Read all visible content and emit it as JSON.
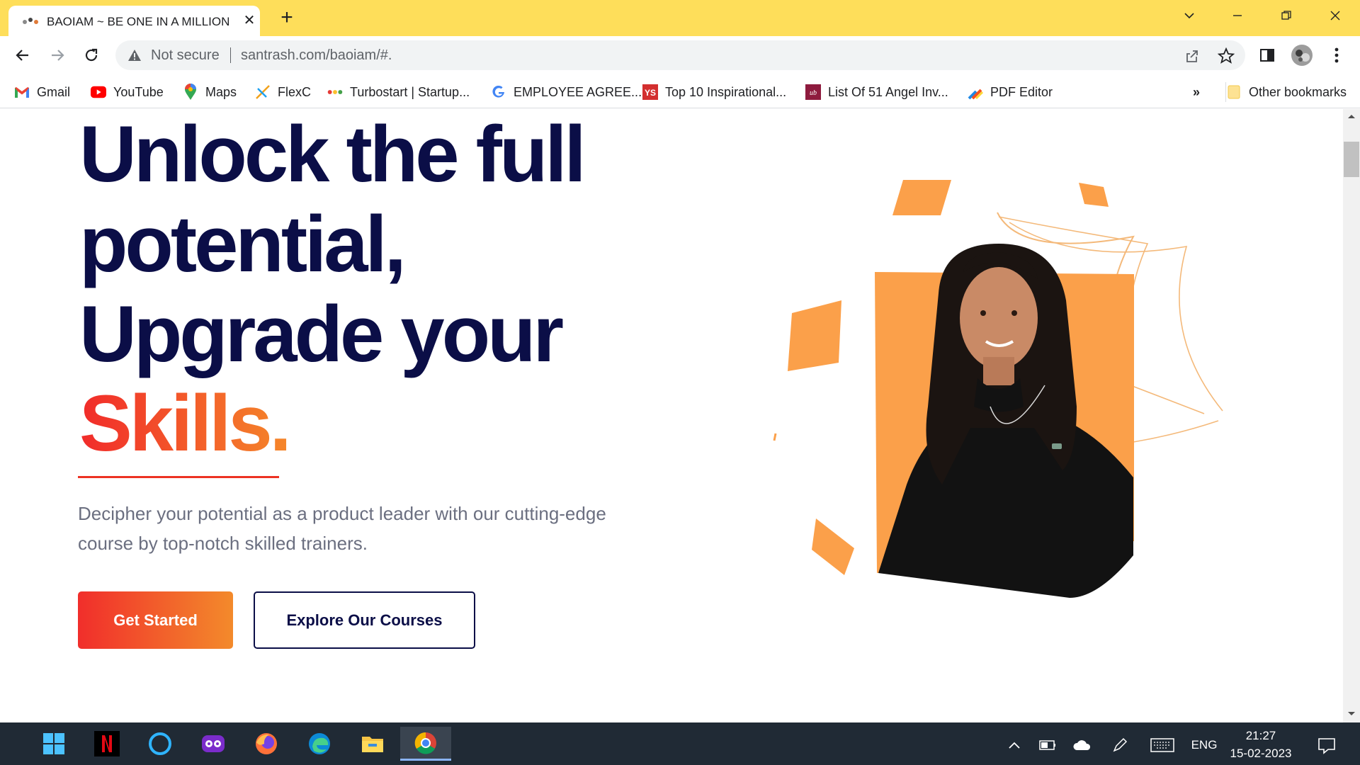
{
  "browser": {
    "tab": {
      "title": "BAOIAM ~ BE ONE IN A MILLION"
    },
    "address_bar": {
      "security_label": "Not secure",
      "url": "santrash.com/baoiam/#."
    },
    "bookmarks": [
      {
        "label": "Gmail",
        "icon": "gmail-icon"
      },
      {
        "label": "YouTube",
        "icon": "youtube-icon"
      },
      {
        "label": "Maps",
        "icon": "maps-icon"
      },
      {
        "label": "FlexC",
        "icon": "flexc-icon"
      },
      {
        "label": "Turbostart | Startup...",
        "icon": "turbostart-icon"
      },
      {
        "label": "EMPLOYEE AGREE...",
        "icon": "google-icon"
      },
      {
        "label": "Top 10 Inspirational...",
        "icon": "yourstory-icon"
      },
      {
        "label": "List Of 51 Angel Inv...",
        "icon": "ub-icon"
      },
      {
        "label": "PDF Editor",
        "icon": "pdf-editor-icon"
      }
    ],
    "bookmarks_overflow": "»",
    "other_bookmarks": "Other bookmarks"
  },
  "hero": {
    "line1": "Unlock the full",
    "line2": "potential,",
    "line3": "Upgrade your",
    "highlight": "Skills.",
    "description": "Decipher your potential as a product leader with our cutting-edge course by top-notch skilled trainers.",
    "primary_cta": "Get Started",
    "secondary_cta": "Explore Our Courses"
  },
  "taskbar": {
    "apps": [
      "start-icon",
      "netflix-icon",
      "cortana-icon",
      "media-icon",
      "firefox-icon",
      "edge-icon",
      "file-explorer-icon",
      "chrome-icon"
    ],
    "language": "ENG",
    "time": "21:27",
    "date": "15-02-2023"
  },
  "colors": {
    "tab_strip": "#fede5a",
    "headline": "#0b0e47",
    "accent_start": "#f12b2a",
    "accent_end": "#f5872a",
    "shape_orange": "#fba04a"
  }
}
